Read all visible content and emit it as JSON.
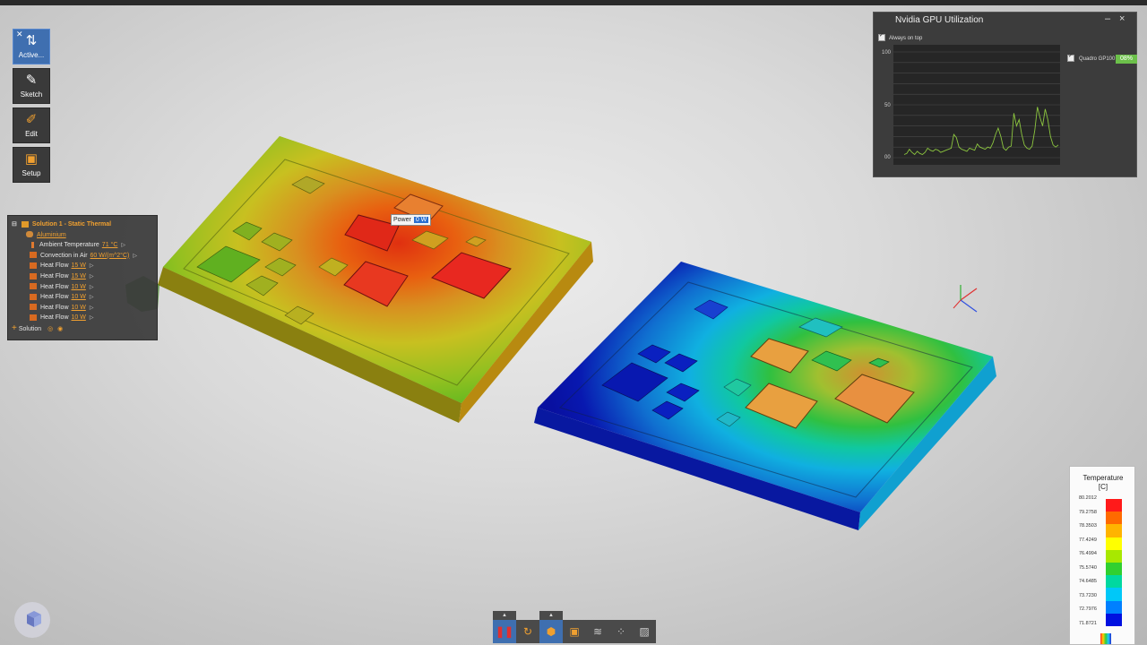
{
  "toolbar": {
    "items": [
      {
        "label": "Active..."
      },
      {
        "label": "Sketch"
      },
      {
        "label": "Edit"
      },
      {
        "label": "Setup"
      }
    ]
  },
  "tree": {
    "root": "Solution 1 - Static Thermal",
    "material": "Aluminium",
    "items": [
      {
        "label": "Ambient Temperature",
        "value": "71 °C"
      },
      {
        "label": "Convection in Air",
        "value": "60 W/(m^2°C)"
      },
      {
        "label": "Heat Flow",
        "value": "15 W"
      },
      {
        "label": "Heat Flow",
        "value": "15 W"
      },
      {
        "label": "Heat Flow",
        "value": "10 W"
      },
      {
        "label": "Heat Flow",
        "value": "10 W"
      },
      {
        "label": "Heat Flow",
        "value": "10 W"
      },
      {
        "label": "Heat Flow",
        "value": "10 W"
      }
    ],
    "solution_label": "Solution"
  },
  "power_field": {
    "label": "Power",
    "value": "0 W"
  },
  "gpu_window": {
    "title": "Nvidia GPU Utilization",
    "always_on_top": "Always on top",
    "device": "Quadro GP100",
    "percent": "08%",
    "y_ticks": [
      "100",
      "50",
      "00"
    ],
    "line_color": "#8cc63f",
    "utilization_samples": [
      3,
      4,
      8,
      5,
      3,
      6,
      4,
      3,
      5,
      9,
      7,
      6,
      8,
      7,
      5,
      6,
      7,
      8,
      9,
      22,
      19,
      10,
      8,
      7,
      6,
      9,
      8,
      7,
      13,
      10,
      9,
      8,
      10,
      9,
      14,
      22,
      28,
      20,
      9,
      7,
      10,
      11,
      42,
      30,
      36,
      22,
      12,
      9,
      8,
      11,
      26,
      48,
      38,
      30,
      46,
      36,
      20,
      12,
      10,
      12
    ]
  },
  "legend": {
    "title": "Temperature",
    "unit": "[C]",
    "values": [
      "80.2012",
      "79.2758",
      "78.3503",
      "77.4249",
      "76.4994",
      "75.5740",
      "74.6485",
      "73.7230",
      "72.7976",
      "71.8721"
    ],
    "colors": [
      "#ff1a1a",
      "#ff6a00",
      "#ffb400",
      "#ffff00",
      "#a8e800",
      "#30d030",
      "#00d8a0",
      "#00c8f8",
      "#0080ff",
      "#0010e0"
    ]
  }
}
